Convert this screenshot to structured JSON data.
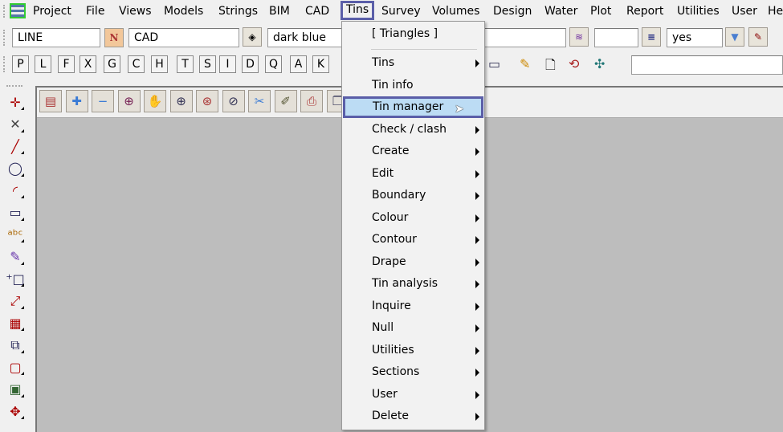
{
  "menubar": {
    "items": [
      "Project",
      "File",
      "Views",
      "Models",
      "Strings",
      "BIM",
      "CAD",
      "Tins",
      "Survey",
      "Volumes",
      "Design",
      "Water",
      "Plot",
      "Report",
      "Utilities",
      "User",
      "He"
    ],
    "active": "Tins"
  },
  "toolbar1": {
    "linestyle": "LINE",
    "name_button": "N",
    "model": "CAD",
    "colour": "dark blue",
    "field4": "",
    "field5": "",
    "yes_value": "yes"
  },
  "toolbar2": {
    "keys": [
      "P",
      "L",
      "F",
      "X",
      "G",
      "C",
      "H",
      "T",
      "S",
      "I",
      "D",
      "Q",
      "A",
      "K"
    ],
    "search": ""
  },
  "tins_menu": {
    "header": "[ Triangles ]",
    "items": [
      {
        "label": "Tins",
        "submenu": true
      },
      {
        "label": "Tin info",
        "submenu": false
      },
      {
        "label": "Tin manager",
        "submenu": false,
        "highlighted": true
      },
      {
        "label": "Check / clash",
        "submenu": true
      },
      {
        "label": "Create",
        "submenu": true
      },
      {
        "label": "Edit",
        "submenu": true
      },
      {
        "label": "Boundary",
        "submenu": true
      },
      {
        "label": "Colour",
        "submenu": true
      },
      {
        "label": "Contour",
        "submenu": true
      },
      {
        "label": "Drape",
        "submenu": true
      },
      {
        "label": "Tin analysis",
        "submenu": true
      },
      {
        "label": "Inquire",
        "submenu": true
      },
      {
        "label": "Null",
        "submenu": true
      },
      {
        "label": "Utilities",
        "submenu": true
      },
      {
        "label": "Sections",
        "submenu": true
      },
      {
        "label": "User",
        "submenu": true
      },
      {
        "label": "Delete",
        "submenu": true
      }
    ]
  },
  "colors": {
    "highlight": "#bcdcf4",
    "highlight_border": "#5a5ea8",
    "canvas": "#bdbdbd"
  }
}
